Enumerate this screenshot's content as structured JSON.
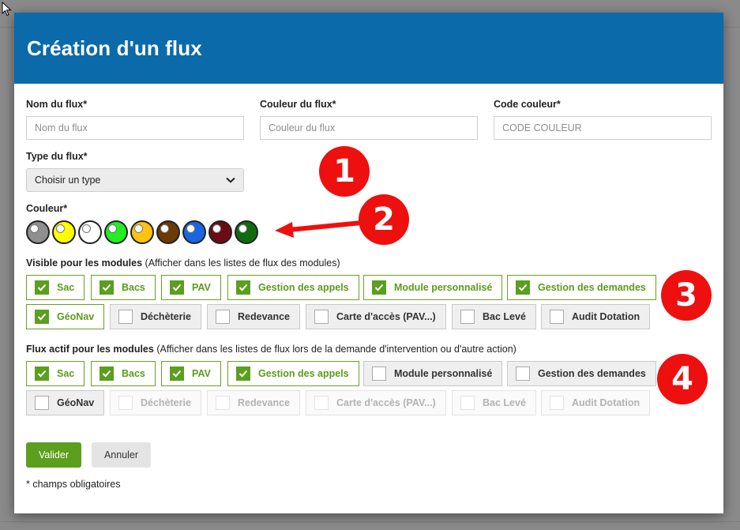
{
  "modal": {
    "title": "Création d'un flux"
  },
  "form": {
    "name_label": "Nom du flux*",
    "name_placeholder": "Nom du flux",
    "color_name_label": "Couleur du flux*",
    "color_name_placeholder": "Couleur du flux",
    "code_label": "Code couleur*",
    "code_placeholder": "CODE COULEUR",
    "type_label": "Type du flux*",
    "type_selected": "Choisir un type",
    "color_label": "Couleur*",
    "swatches": [
      "#8f8f8f",
      "#ffff00",
      "#ffffff",
      "#22ee22",
      "#ffc20e",
      "#6b3a05",
      "#1a66e0",
      "#6e0a14",
      "#0f6b10"
    ]
  },
  "visible_modules": {
    "title": "Visible pour les modules",
    "hint": "(Afficher dans les listes de flux des modules)",
    "items": [
      {
        "label": "Sac",
        "checked": true
      },
      {
        "label": "Bacs",
        "checked": true
      },
      {
        "label": "PAV",
        "checked": true
      },
      {
        "label": "Gestion des appels",
        "checked": true
      },
      {
        "label": "Module personnalisé",
        "checked": true
      },
      {
        "label": "Gestion des demandes",
        "checked": true
      },
      {
        "label": "GéoNav",
        "checked": true
      },
      {
        "label": "Déchèterie",
        "checked": false
      },
      {
        "label": "Redevance",
        "checked": false
      },
      {
        "label": "Carte d'accès (PAV...)",
        "checked": false
      },
      {
        "label": "Bac Levé",
        "checked": false
      },
      {
        "label": "Audit Dotation",
        "checked": false
      }
    ]
  },
  "active_modules": {
    "title": "Flux actif pour les modules",
    "hint": "(Afficher dans les listes de flux lors de la demande d'intervention ou d'autre action)",
    "items": [
      {
        "label": "Sac",
        "checked": true
      },
      {
        "label": "Bacs",
        "checked": true
      },
      {
        "label": "PAV",
        "checked": true
      },
      {
        "label": "Gestion des appels",
        "checked": true
      },
      {
        "label": "Module personnalisé",
        "checked": false
      },
      {
        "label": "Gestion des demandes",
        "checked": false
      },
      {
        "label": "GéoNav",
        "checked": false
      },
      {
        "label": "Déchèterie",
        "checked": false,
        "disabled": true
      },
      {
        "label": "Redevance",
        "checked": false,
        "disabled": true
      },
      {
        "label": "Carte d'accès (PAV...)",
        "checked": false,
        "disabled": true
      },
      {
        "label": "Bac Levé",
        "checked": false,
        "disabled": true
      },
      {
        "label": "Audit Dotation",
        "checked": false,
        "disabled": true
      }
    ]
  },
  "buttons": {
    "submit": "Valider",
    "cancel": "Annuler"
  },
  "footnote": "* champs obligatoires",
  "annotations": [
    "1",
    "2",
    "3",
    "4"
  ],
  "colors": {
    "header": "#0b6aa9",
    "accent": "#5c9e1e",
    "annotation": "#ee0f0f"
  }
}
